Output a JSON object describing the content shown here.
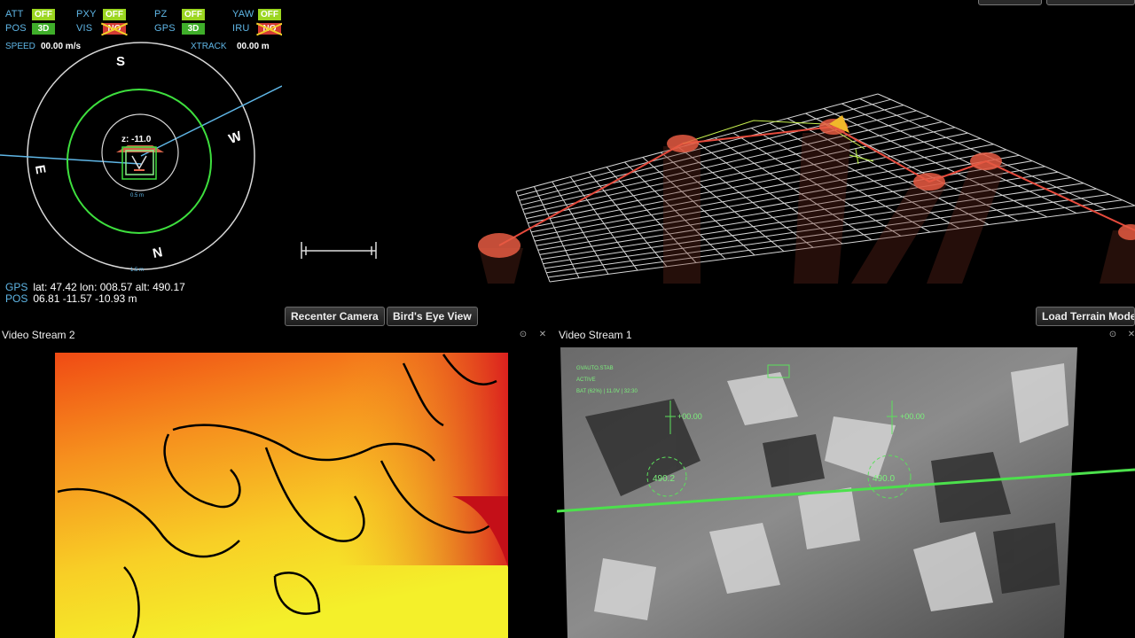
{
  "hud": {
    "status": [
      {
        "label": "ATT",
        "badge": "OFF",
        "state": "off"
      },
      {
        "label": "POS",
        "badge": "3D",
        "state": "on"
      },
      {
        "label": "PXY",
        "badge": "OFF",
        "state": "off"
      },
      {
        "label": "VIS",
        "badge": "NO",
        "state": "no"
      },
      {
        "label": "PZ",
        "badge": "OFF",
        "state": "off"
      },
      {
        "label": "GPS",
        "badge": "3D",
        "state": "on"
      },
      {
        "label": "YAW",
        "badge": "OFF",
        "state": "off"
      },
      {
        "label": "IRU",
        "badge": "NO",
        "state": "no"
      }
    ],
    "speed_label": "SPEED",
    "speed_value": "00.00 m/s",
    "xtrack_label": "XTRACK",
    "xtrack_value": "00.00 m",
    "compass": {
      "s": "S",
      "w": "W",
      "e": "E",
      "n": "N"
    },
    "z_readout": "z: -11.0",
    "inner_range": "0.5 m",
    "outer_range": "1.5 m",
    "gps_label": "GPS",
    "gps_value": "lat: 47.42  lon: 008.57  alt: 490.17",
    "pos_label": "POS",
    "pos_value": "06.81  -11.57  -10.93 m",
    "colors": {
      "label": "#5fb6e6",
      "ring": "#3ee03e",
      "off_badge": "#9bd620",
      "no_badge": "#d23a34"
    }
  },
  "toolbar": {
    "recenter": "Recenter Camera",
    "birds_eye": "Bird's Eye View",
    "load_terrain": "Load Terrain Model"
  },
  "stream2": {
    "title": "Video Stream 2",
    "float_icon": "float-icon",
    "close_icon": "close-icon"
  },
  "stream1": {
    "title": "Video Stream 1",
    "overlay": {
      "mode": "GVAUTO.STAB",
      "state": "ACTIVE",
      "battery": "BAT (62%) | 11.0V | 32:30",
      "alt_left": "+00.00",
      "alt_right": "+00.00",
      "heading_left": "490.2",
      "heading_right": "490.0"
    }
  }
}
